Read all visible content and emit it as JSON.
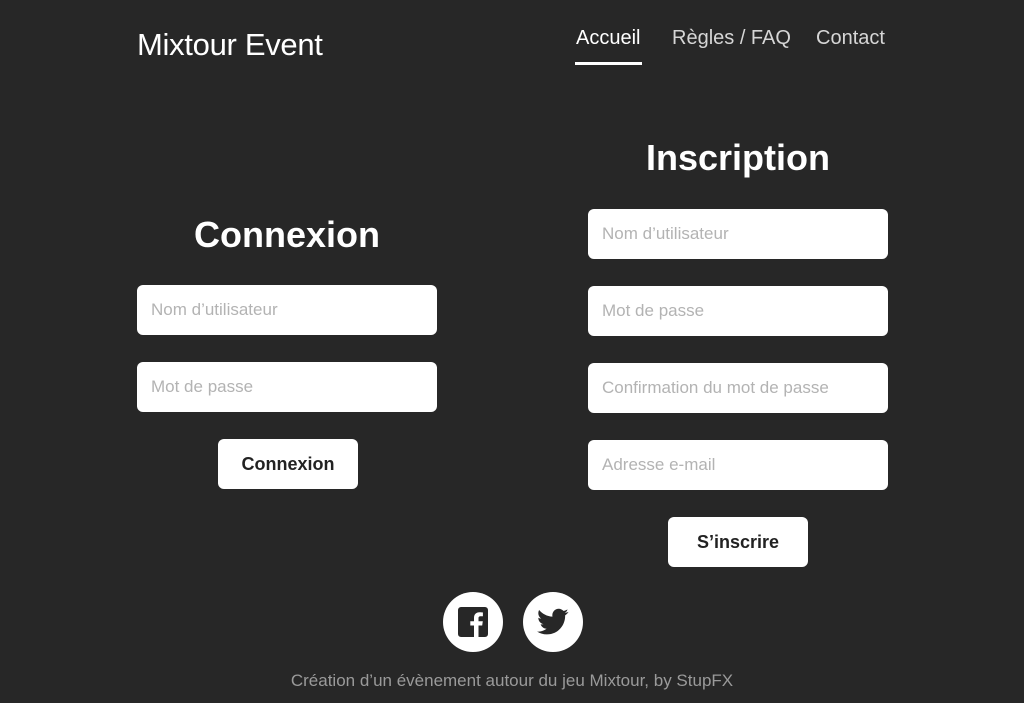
{
  "header": {
    "brand": "Mixtour Event",
    "nav": [
      {
        "label": "Accueil",
        "active": true
      },
      {
        "label": "Règles / FAQ",
        "active": false
      },
      {
        "label": "Contact",
        "active": false
      }
    ]
  },
  "login": {
    "title": "Connexion",
    "username_placeholder": "Nom d’utilisateur",
    "password_placeholder": "Mot de passe",
    "submit_label": "Connexion"
  },
  "register": {
    "title": "Inscription",
    "username_placeholder": "Nom d’utilisateur",
    "password_placeholder": "Mot de passe",
    "confirm_placeholder": "Confirmation du mot de passe",
    "email_placeholder": "Adresse e-mail",
    "submit_label": "S’inscrire"
  },
  "social": {
    "items": [
      {
        "icon": "facebook-icon"
      },
      {
        "icon": "twitter-icon"
      }
    ]
  },
  "footer": {
    "text": "Création d’un évènement autour du jeu Mixtour, by StupFX"
  },
  "colors": {
    "background": "#272727",
    "text": "#ffffff",
    "nav_inactive": "#d6d6d6",
    "placeholder": "#b3b3b3",
    "footer": "#9a9a9a"
  }
}
